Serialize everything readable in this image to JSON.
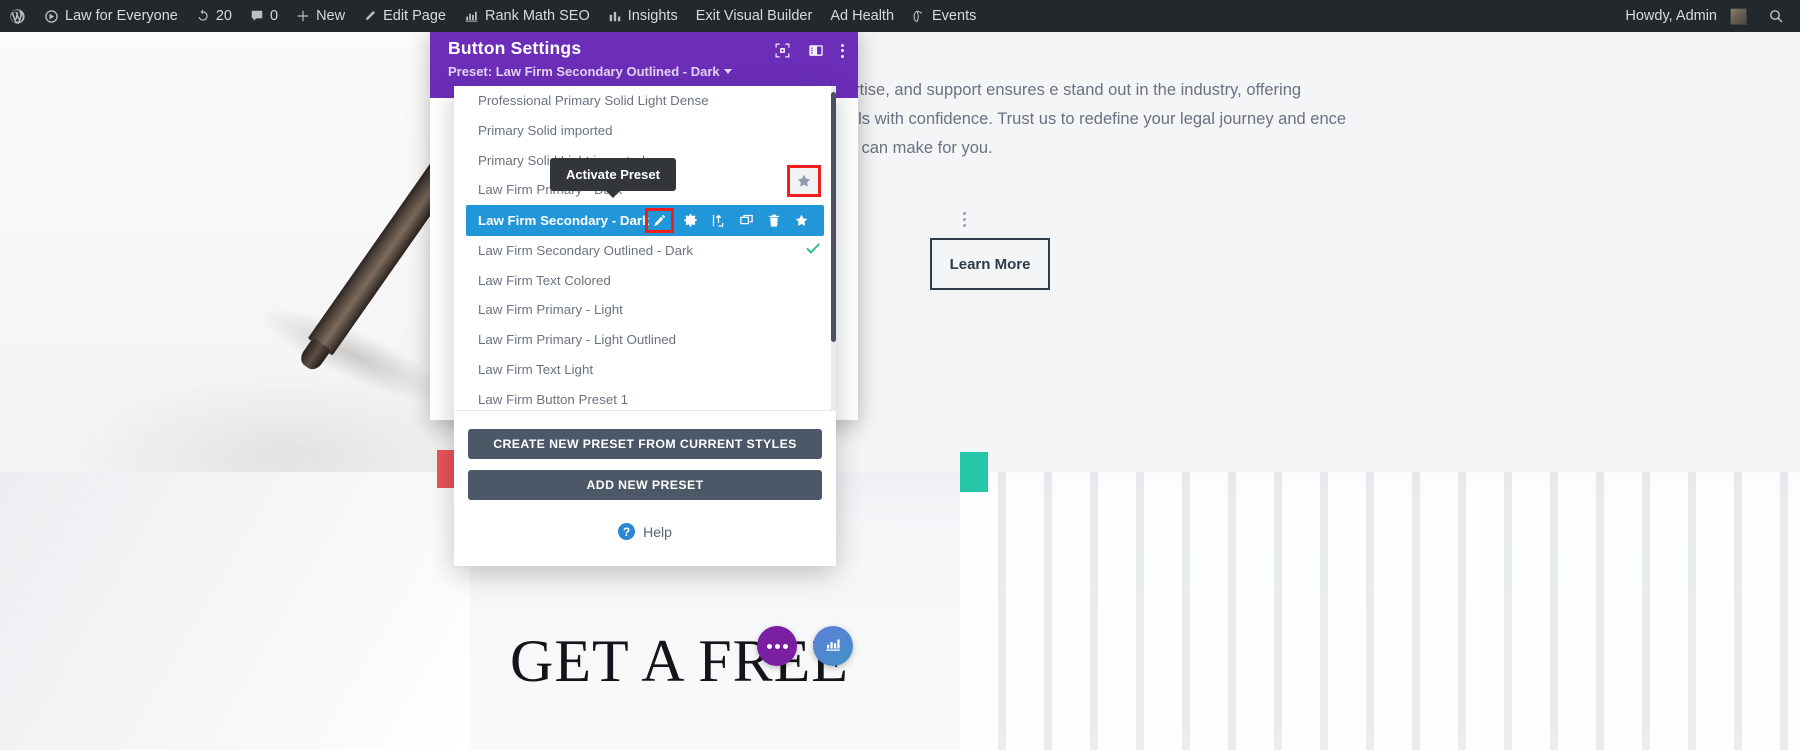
{
  "adminbar": {
    "left_items": [
      {
        "label": "",
        "icon": "wordpress-logo-icon"
      },
      {
        "label": "Law for Everyone",
        "icon": "site-icon"
      },
      {
        "label": "20",
        "icon": "updates-icon"
      },
      {
        "label": "0",
        "icon": "comments-icon"
      },
      {
        "label": "New",
        "icon": "plus-icon"
      },
      {
        "label": "Edit Page",
        "icon": "pencil-icon"
      },
      {
        "label": "Rank Math SEO",
        "icon": "rankmath-icon"
      },
      {
        "label": "Insights",
        "icon": "bar-chart-icon"
      },
      {
        "label": "Exit Visual Builder",
        "icon": ""
      },
      {
        "label": "Ad Health",
        "icon": ""
      },
      {
        "label": "Events",
        "icon": "events-icon"
      }
    ],
    "howdy": "Howdy, Admin",
    "search_icon": "search-icon"
  },
  "modal": {
    "title": "Button Settings",
    "preset_label": "Preset: Law Firm Secondary Outlined - Dark",
    "icons": [
      "focus-target-icon",
      "layout-panel-icon",
      "kebab-menu-icon"
    ]
  },
  "preset_panel": {
    "tooltip": "Activate Preset",
    "items": [
      {
        "label": "Professional Primary Solid Light Dense",
        "state": "normal"
      },
      {
        "label": "Primary Solid imported",
        "state": "normal"
      },
      {
        "label": "Primary Solid Light imported",
        "state": "normal"
      },
      {
        "label": "Law Firm Primary - Dark",
        "state": "normal"
      },
      {
        "label": "Law Firm Secondary - Dark",
        "state": "active"
      },
      {
        "label": "Law Firm Secondary Outlined - Dark",
        "state": "checked"
      },
      {
        "label": "Law Firm Text Colored",
        "state": "normal"
      },
      {
        "label": "Law Firm Primary - Light",
        "state": "normal"
      },
      {
        "label": "Law Firm Primary - Light Outlined",
        "state": "normal"
      },
      {
        "label": "Law Firm Text Light",
        "state": "normal"
      },
      {
        "label": "Law Firm Button Preset 1",
        "state": "normal"
      }
    ],
    "active_row_actions": [
      "rename-pencil-icon",
      "settings-gear-icon",
      "export-icon",
      "duplicate-icon",
      "delete-trash-icon",
      "favorite-star-icon"
    ],
    "create_preset_label": "CREATE NEW PRESET FROM CURRENT STYLES",
    "add_preset_label": "ADD NEW PRESET",
    "help_label": "Help",
    "help_badge": "?"
  },
  "page": {
    "body_text": "nwavering commitment to integrity, expertise, and support ensures e stand out in the industry, offering innovative solutions to help you your goals with confidence. Trust us to redefine your legal journey and ence the difference that Paralegal Onboarding can make for you.",
    "learn_more": "Learn More",
    "heading": "GET A FREE"
  },
  "colors": {
    "modal_purple": "#6c2eb9",
    "active_blue": "#2196d8",
    "highlight_red": "#f01f1f",
    "check_green": "#2bbf9a",
    "button_slate": "#4c5768",
    "admin_bar": "#23282d",
    "accent_red_block": "#e8545b",
    "accent_teal_block": "#26c6a8"
  }
}
